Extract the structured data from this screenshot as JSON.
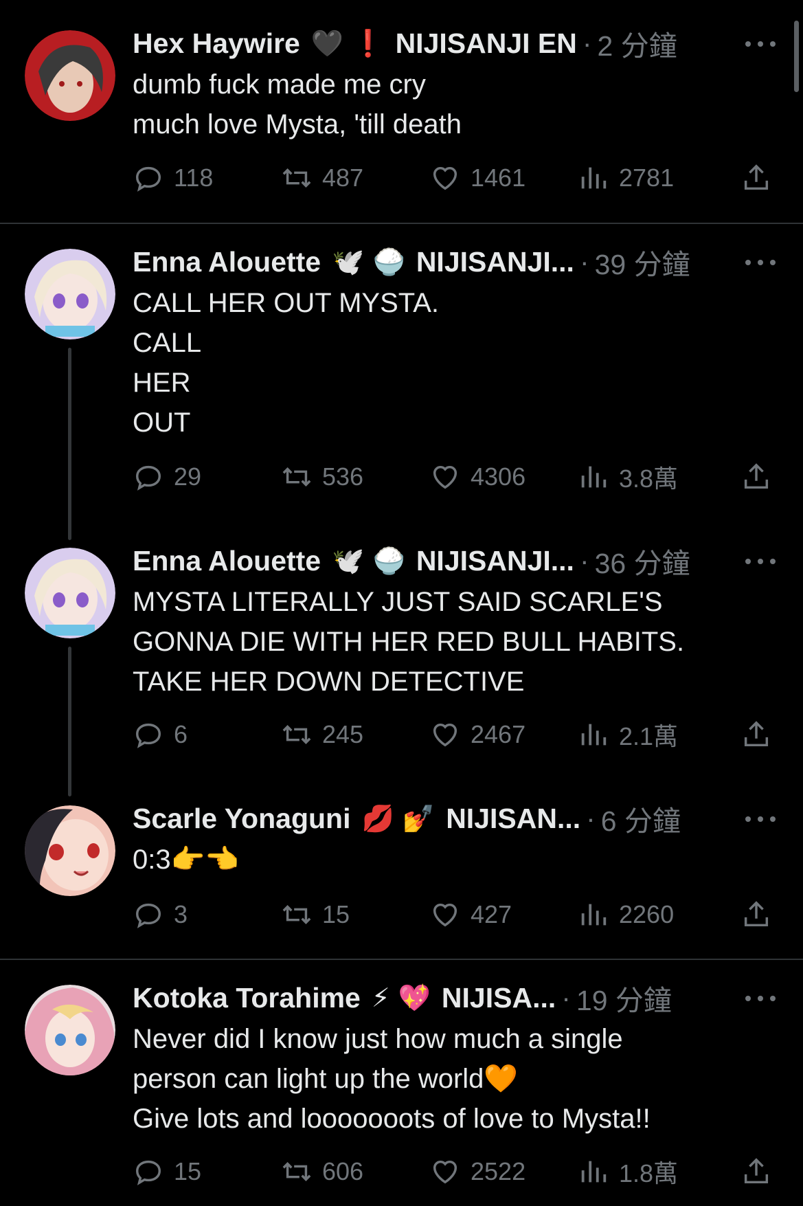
{
  "tweets": [
    {
      "name": "Hex Haywire",
      "emojis": "🖤 ❗",
      "affiliation": "NIJISANJI EN",
      "time": "2 分鐘",
      "lines": [
        "dumb fuck made me cry",
        "much love Mysta, 'till death"
      ],
      "replies": "118",
      "retweets": "487",
      "likes": "1461",
      "views": "2781",
      "avatar_color": "#b81e22"
    },
    {
      "name": "Enna Alouette",
      "emojis": "🕊️ 🍚",
      "affiliation": "NIJISANJI...",
      "time": "39 分鐘",
      "lines": [
        "CALL HER OUT MYSTA.",
        "CALL",
        "HER",
        "OUT"
      ],
      "replies": "29",
      "retweets": "536",
      "likes": "4306",
      "views": "3.8萬",
      "avatar_color": "#c9b9e6"
    },
    {
      "name": "Enna Alouette",
      "emojis": "🕊️ 🍚",
      "affiliation": "NIJISANJI...",
      "time": "36 分鐘",
      "lines": [
        "MYSTA LITERALLY JUST SAID SCARLE'S",
        "GONNA DIE WITH HER RED BULL HABITS.",
        "TAKE HER DOWN DETECTIVE"
      ],
      "replies": "6",
      "retweets": "245",
      "likes": "2467",
      "views": "2.1萬",
      "avatar_color": "#c9b9e6"
    },
    {
      "name": "Scarle Yonaguni",
      "emojis": "💋 💅",
      "affiliation": "NIJISAN...",
      "time": "6 分鐘",
      "lines": [
        "0:3👉👈"
      ],
      "replies": "3",
      "retweets": "15",
      "likes": "427",
      "views": "2260",
      "avatar_color": "#f2c4b8"
    },
    {
      "name": "Kotoka Torahime",
      "emojis": "⚡ 💖",
      "affiliation": "NIJISA...",
      "time": "19 分鐘",
      "lines": [
        "Never did I know just how much a single",
        "person can light up the world🧡",
        "Give lots and looooooots of love to Mysta!!"
      ],
      "replies": "15",
      "retweets": "606",
      "likes": "2522",
      "views": "1.8萬",
      "avatar_color": "#e0a8b8"
    }
  ],
  "separator": "·",
  "icons": {
    "reply": "reply-icon",
    "retweet": "retweet-icon",
    "like": "heart-icon",
    "views": "views-icon",
    "share": "share-icon",
    "more": "more-icon"
  }
}
